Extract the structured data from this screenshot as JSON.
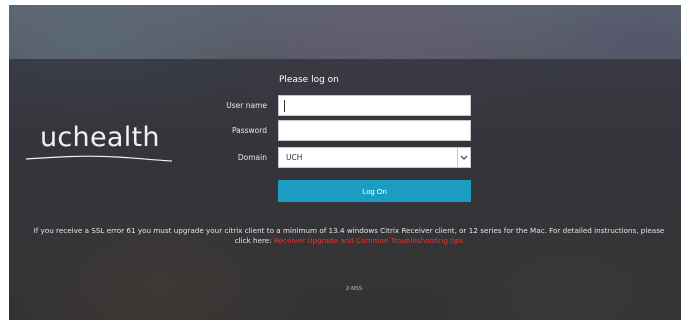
{
  "brand": {
    "logo_text": "uchealth",
    "logo_color": "#f2f2f2"
  },
  "login_form": {
    "title": "Please log on",
    "username": {
      "label": "User name",
      "value": ""
    },
    "password": {
      "label": "Password",
      "value": ""
    },
    "domain": {
      "label": "Domain",
      "selected": "UCH"
    },
    "submit_label": "Log On",
    "accent_color": "#1c9cc0"
  },
  "notice": {
    "text": "If you receive a SSL error 61 you must upgrade your citrix client to a minimum of 13.4 windows Citrix Receiver client, or 12 series for the Mac. For detailed instructions, please click here: ",
    "link_text": "Receiver Upgrade and Common Troubleshooting tips",
    "link_color": "#e8362b"
  },
  "footer": {
    "server_code": "2-NSS"
  },
  "icons": {
    "domain_dropdown": "chevron-down-icon"
  }
}
